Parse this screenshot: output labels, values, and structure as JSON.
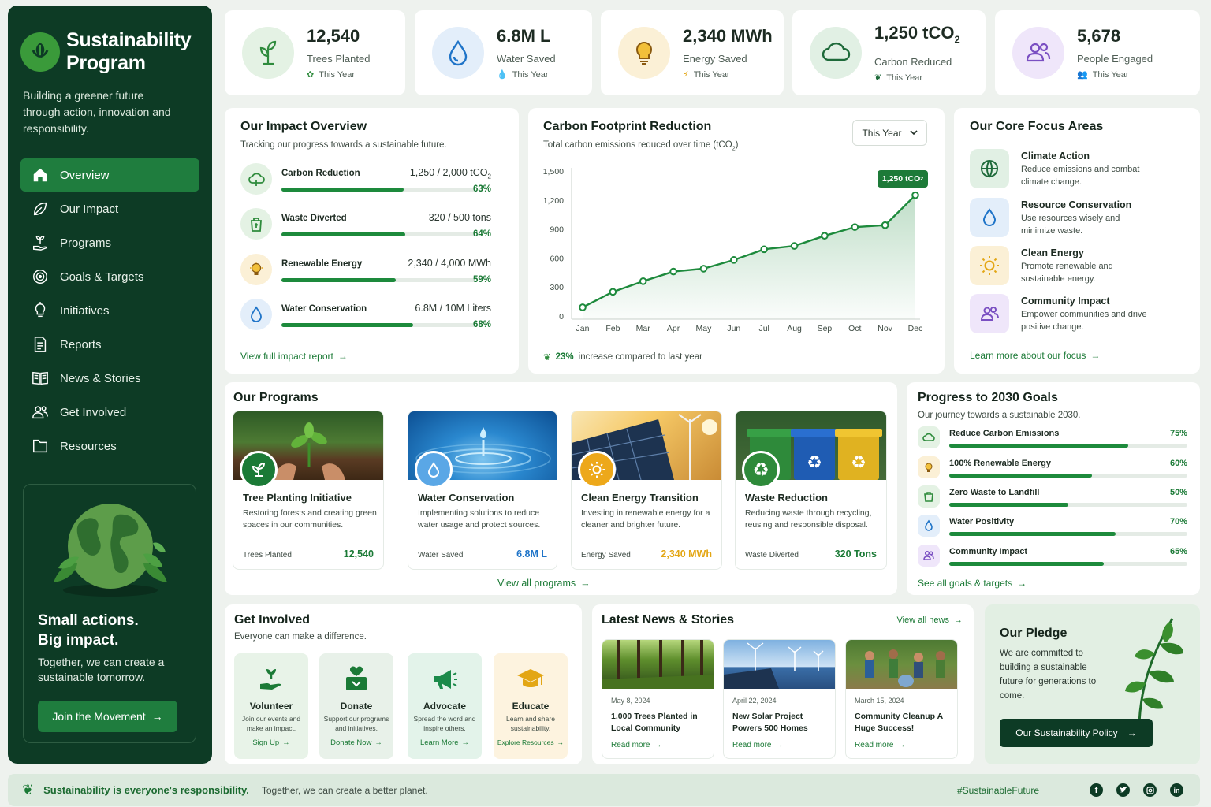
{
  "brand": {
    "title": "Sustainability Program",
    "tagline": "Building a greener future through action, innovation and responsibility."
  },
  "nav": [
    {
      "label": "Overview",
      "icon": "home-icon"
    },
    {
      "label": "Our Impact",
      "icon": "leaf-icon"
    },
    {
      "label": "Programs",
      "icon": "plant-hand-icon"
    },
    {
      "label": "Goals & Targets",
      "icon": "target-icon"
    },
    {
      "label": "Initiatives",
      "icon": "lightbulb-icon"
    },
    {
      "label": "Reports",
      "icon": "document-icon"
    },
    {
      "label": "News & Stories",
      "icon": "newspaper-icon"
    },
    {
      "label": "Get Involved",
      "icon": "people-icon"
    },
    {
      "label": "Resources",
      "icon": "folder-icon"
    }
  ],
  "promo": {
    "title_1": "Small actions.",
    "title_2": "Big impact.",
    "text": "Together, we can create a sustainable tomorrow.",
    "button": "Join the Movement"
  },
  "stats": [
    {
      "value": "12,540",
      "label": "Trees Planted",
      "sub": "This Year",
      "color": "#2e8b3c",
      "bg": "#e4f2e4"
    },
    {
      "value": "6.8M L",
      "label": "Water Saved",
      "sub": "This Year",
      "color": "#1f74c8",
      "bg": "#e3eefa"
    },
    {
      "value": "2,340 MWh",
      "label": "Energy Saved",
      "sub": "This Year",
      "color": "#e3a614",
      "bg": "#fbf0d6"
    },
    {
      "value": "1,250 tCO",
      "value_sub": "2",
      "label": "Carbon Reduced",
      "sub": "This Year",
      "color": "#1e6a3a",
      "bg": "#e1f0e4"
    },
    {
      "value": "5,678",
      "label": "People Engaged",
      "sub": "This Year",
      "color": "#7a4fc2",
      "bg": "#efe6fa"
    }
  ],
  "impact": {
    "title": "Our Impact Overview",
    "subtitle": "Tracking our progress towards a sustainable future.",
    "link": "View full impact report",
    "rows": [
      {
        "name": "Carbon Reduction",
        "value": "1,250 / 2,000 tCO",
        "value_sub": "2",
        "pct": "63%",
        "fill": 0.63,
        "color": "#2e8b3c",
        "bg": "#e4f2e4"
      },
      {
        "name": "Waste Diverted",
        "value": "320 / 500 tons",
        "pct": "64%",
        "fill": 0.64,
        "color": "#2e8b3c",
        "bg": "#e4f2e4"
      },
      {
        "name": "Renewable Energy",
        "value": "2,340 / 4,000 MWh",
        "pct": "59%",
        "fill": 0.59,
        "color": "#e3a614",
        "bg": "#fbf0d6"
      },
      {
        "name": "Water Conservation",
        "value": "6.8M / 10M Liters",
        "pct": "68%",
        "fill": 0.68,
        "color": "#1f74c8",
        "bg": "#e3eefa"
      }
    ]
  },
  "carbon": {
    "title": "Carbon Footprint Reduction",
    "subtitle": "Total carbon emissions reduced over time (tCO",
    "subtitle_sub": "2",
    "subtitle_end": ")",
    "dropdown": "This Year",
    "callout": "1,250 tCO",
    "callout_sub": "2",
    "note_pct": "23%",
    "note_text": "increase compared to last year"
  },
  "chart_data": {
    "type": "line",
    "categories": [
      "Jan",
      "Feb",
      "Mar",
      "Apr",
      "May",
      "Jun",
      "Jul",
      "Aug",
      "Sep",
      "Oct",
      "Nov",
      "Dec"
    ],
    "values": [
      90,
      250,
      360,
      460,
      490,
      580,
      690,
      725,
      830,
      920,
      940,
      1250
    ],
    "ylim": [
      0,
      1500
    ],
    "yticks": [
      "1,500",
      "1,200",
      "900",
      "600",
      "300",
      "0"
    ],
    "ytick_values": [
      1500,
      1200,
      900,
      600,
      300,
      0
    ],
    "grid": false,
    "color": "#1d8a3c"
  },
  "focus": {
    "title": "Our Core Focus Areas",
    "link": "Learn more about our focus",
    "items": [
      {
        "title": "Climate Action",
        "desc": "Reduce emissions and combat climate change.",
        "icon": "globe-icon",
        "color": "#1e6a3a",
        "bg": "#e1f0e4"
      },
      {
        "title": "Resource Conservation",
        "desc": "Use resources wisely and minimize waste.",
        "icon": "water-drop-icon",
        "color": "#1f74c8",
        "bg": "#e3eefa"
      },
      {
        "title": "Clean Energy",
        "desc": "Promote renewable and sustainable energy.",
        "icon": "sun-icon",
        "color": "#e3a614",
        "bg": "#fbf0d6"
      },
      {
        "title": "Community Impact",
        "desc": "Empower communities and drive positive change.",
        "icon": "people-icon",
        "color": "#7a4fc2",
        "bg": "#efe6fa"
      }
    ]
  },
  "programs": {
    "title": "Our Programs",
    "link": "View all programs",
    "items": [
      {
        "title": "Tree Planting Initiative",
        "desc": "Restoring forests and creating green spaces in our communities.",
        "metric_label": "Trees Planted",
        "metric_value": "12,540",
        "color": "#1b7a36"
      },
      {
        "title": "Water Conservation",
        "desc": "Implementing solutions to reduce water usage and protect sources.",
        "metric_label": "Water Saved",
        "metric_value": "6.8M L",
        "color": "#1f74c8"
      },
      {
        "title": "Clean Energy Transition",
        "desc": "Investing in renewable energy for a cleaner and brighter future.",
        "metric_label": "Energy Saved",
        "metric_value": "2,340 MWh",
        "color": "#e3a614"
      },
      {
        "title": "Waste Reduction",
        "desc": "Reducing waste through recycling, reusing and responsible disposal.",
        "metric_label": "Waste Diverted",
        "metric_value": "320 Tons",
        "color": "#1b7a36"
      }
    ]
  },
  "goals": {
    "title": "Progress to 2030 Goals",
    "subtitle": "Our journey towards a sustainable 2030.",
    "link": "See all goals & targets",
    "rows": [
      {
        "name": "Reduce Carbon Emissions",
        "pct": "75%",
        "fill": 0.75,
        "color": "#2e8b3c",
        "bg": "#e4f2e4"
      },
      {
        "name": "100% Renewable Energy",
        "pct": "60%",
        "fill": 0.6,
        "color": "#e3a614",
        "bg": "#fbf0d6"
      },
      {
        "name": "Zero Waste to Landfill",
        "pct": "50%",
        "fill": 0.5,
        "color": "#2e8b3c",
        "bg": "#e4f2e4"
      },
      {
        "name": "Water Positivity",
        "pct": "70%",
        "fill": 0.7,
        "color": "#1f74c8",
        "bg": "#e3eefa"
      },
      {
        "name": "Community Impact",
        "pct": "65%",
        "fill": 0.65,
        "color": "#7a4fc2",
        "bg": "#efe6fa"
      }
    ]
  },
  "involved": {
    "title": "Get Involved",
    "subtitle": "Everyone can make a difference.",
    "items": [
      {
        "title": "Volunteer",
        "desc": "Join our events and make an impact.",
        "link": "Sign Up",
        "bg": "#e8f3e8"
      },
      {
        "title": "Donate",
        "desc": "Support our programs and initiatives.",
        "link": "Donate Now",
        "bg": "#e8f1e9"
      },
      {
        "title": "Advocate",
        "desc": "Spread the word and inspire others.",
        "link": "Learn More",
        "bg": "#e3f3ea"
      },
      {
        "title": "Educate",
        "desc": "Learn and share sustainability.",
        "link": "Explore Resources",
        "bg": "#fdf3df"
      }
    ]
  },
  "news": {
    "title": "Latest News & Stories",
    "link": "View all news",
    "items": [
      {
        "date": "May 8, 2024",
        "title": "1,000 Trees Planted in Local Community",
        "link": "Read more"
      },
      {
        "date": "April 22, 2024",
        "title": "New Solar Project Powers 500 Homes",
        "link": "Read more"
      },
      {
        "date": "March 15, 2024",
        "title": "Community Cleanup A Huge Success!",
        "link": "Read more"
      }
    ]
  },
  "pledge": {
    "title": "Our Pledge",
    "text": "We are committed to building a sustainable future for generations to come.",
    "button": "Our Sustainability Policy"
  },
  "footer": {
    "main": "Sustainability is everyone's responsibility.",
    "sub": "Together, we can create a better planet.",
    "hashtag": "#SustainableFuture",
    "socials": [
      "facebook-icon",
      "twitter-icon",
      "instagram-icon",
      "linkedin-icon"
    ]
  }
}
